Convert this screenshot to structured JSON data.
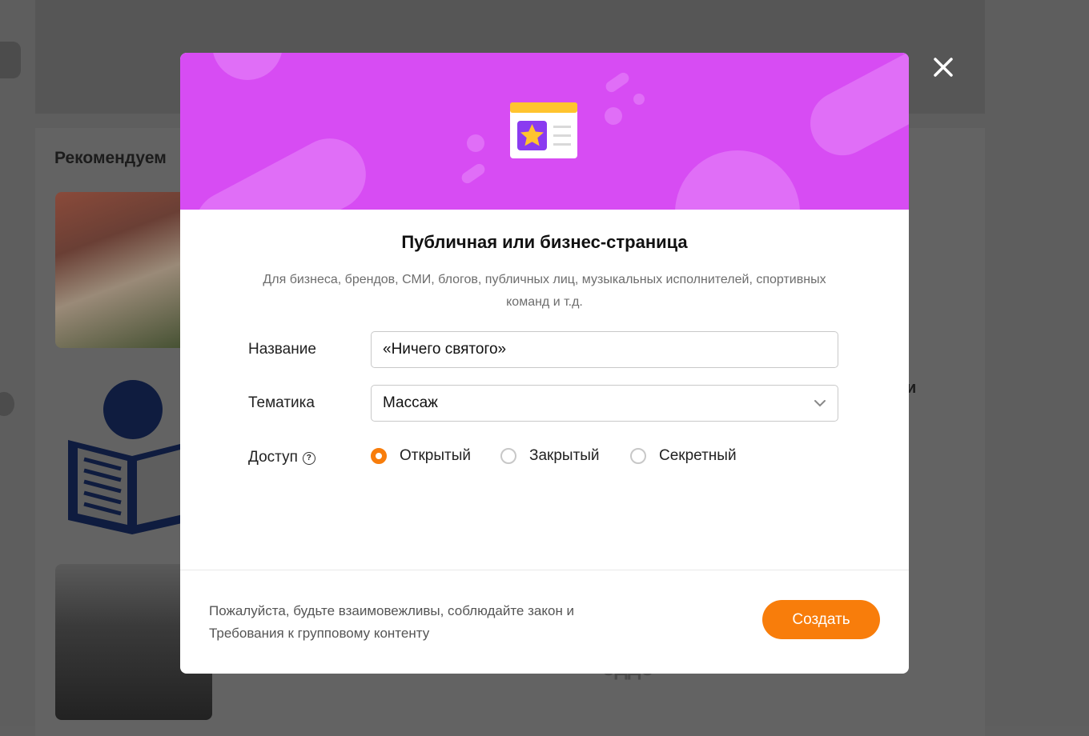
{
  "background": {
    "heading": "Рекомендуем",
    "right_text": "и",
    "bottom_text": "оддо"
  },
  "modal": {
    "title": "Публичная или бизнес-страница",
    "subtitle": "Для бизнеса, брендов, СМИ, блогов, публичных лиц, музыкальных исполнителей, спортивных команд и т.д.",
    "form": {
      "name_label": "Название",
      "name_value": "«Ничего святого»",
      "topic_label": "Тематика",
      "topic_value": "Массаж",
      "access_label": "Доступ",
      "access_help_icon": "question-circle-icon",
      "access_options": [
        "Открытый",
        "Закрытый",
        "Секретный"
      ],
      "access_selected": "Открытый"
    },
    "footer_text": "Пожалуйста, будьте взаимовежливы, соблюдайте закон и Требования к групповому контенту",
    "create_button": "Создать"
  },
  "colors": {
    "accent": "#f87d0b",
    "banner": "#d74cf3",
    "overlay": "#5e5e5e"
  }
}
